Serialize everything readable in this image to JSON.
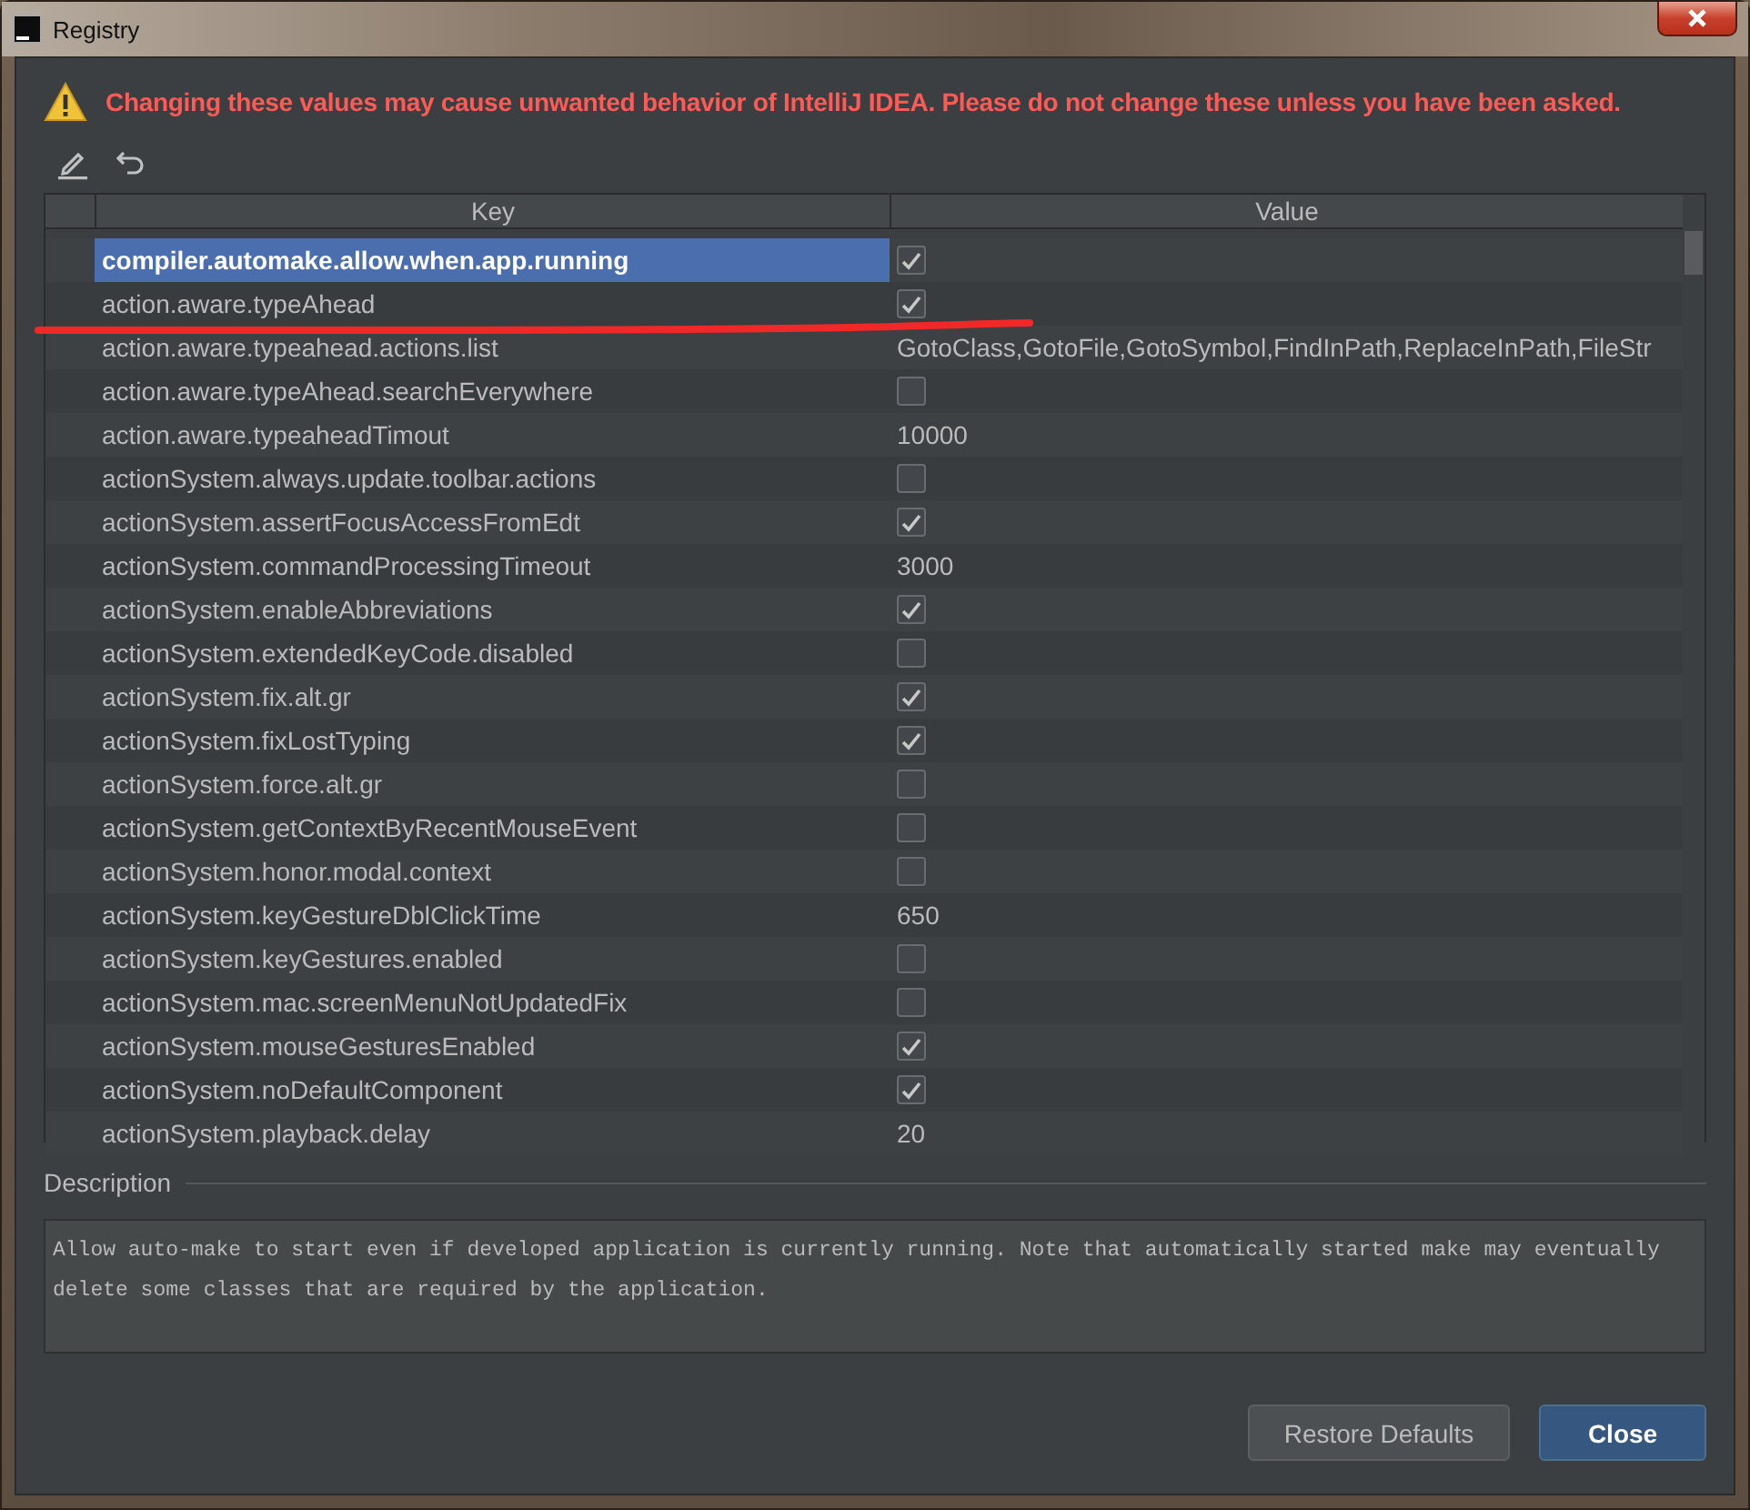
{
  "window": {
    "title": "Registry"
  },
  "warning": "Changing these values may cause unwanted behavior of IntelliJ IDEA. Please do not change these unless you have been asked.",
  "table": {
    "columns": [
      "Key",
      "Value"
    ],
    "rows": [
      {
        "key": "compiler.automake.allow.when.app.running",
        "kind": "bool",
        "checked": true,
        "selected": true
      },
      {
        "key": "action.aware.typeAhead",
        "kind": "bool",
        "checked": true,
        "selected": false
      },
      {
        "key": "action.aware.typeahead.actions.list",
        "kind": "text",
        "value": "GotoClass,GotoFile,GotoSymbol,FindInPath,ReplaceInPath,FileStr",
        "selected": false
      },
      {
        "key": "action.aware.typeAhead.searchEverywhere",
        "kind": "bool",
        "checked": false,
        "selected": false
      },
      {
        "key": "action.aware.typeaheadTimout",
        "kind": "text",
        "value": "10000",
        "selected": false
      },
      {
        "key": "actionSystem.always.update.toolbar.actions",
        "kind": "bool",
        "checked": false,
        "selected": false
      },
      {
        "key": "actionSystem.assertFocusAccessFromEdt",
        "kind": "bool",
        "checked": true,
        "selected": false
      },
      {
        "key": "actionSystem.commandProcessingTimeout",
        "kind": "text",
        "value": "3000",
        "selected": false
      },
      {
        "key": "actionSystem.enableAbbreviations",
        "kind": "bool",
        "checked": true,
        "selected": false
      },
      {
        "key": "actionSystem.extendedKeyCode.disabled",
        "kind": "bool",
        "checked": false,
        "selected": false
      },
      {
        "key": "actionSystem.fix.alt.gr",
        "kind": "bool",
        "checked": true,
        "selected": false
      },
      {
        "key": "actionSystem.fixLostTyping",
        "kind": "bool",
        "checked": true,
        "selected": false
      },
      {
        "key": "actionSystem.force.alt.gr",
        "kind": "bool",
        "checked": false,
        "selected": false
      },
      {
        "key": "actionSystem.getContextByRecentMouseEvent",
        "kind": "bool",
        "checked": false,
        "selected": false
      },
      {
        "key": "actionSystem.honor.modal.context",
        "kind": "bool",
        "checked": false,
        "selected": false
      },
      {
        "key": "actionSystem.keyGestureDblClickTime",
        "kind": "text",
        "value": "650",
        "selected": false
      },
      {
        "key": "actionSystem.keyGestures.enabled",
        "kind": "bool",
        "checked": false,
        "selected": false
      },
      {
        "key": "actionSystem.mac.screenMenuNotUpdatedFix",
        "kind": "bool",
        "checked": false,
        "selected": false
      },
      {
        "key": "actionSystem.mouseGesturesEnabled",
        "kind": "bool",
        "checked": true,
        "selected": false
      },
      {
        "key": "actionSystem.noDefaultComponent",
        "kind": "bool",
        "checked": true,
        "selected": false
      },
      {
        "key": "actionSystem.playback.delay",
        "kind": "text",
        "value": "20",
        "selected": false
      }
    ]
  },
  "description": {
    "label": "Description",
    "text": "Allow auto-make to start even if developed application is currently running. Note that automatically started make may eventually delete some classes that are required by the application."
  },
  "buttons": [
    {
      "label": "Restore Defaults",
      "default": false
    },
    {
      "label": "Close",
      "default": true
    }
  ]
}
